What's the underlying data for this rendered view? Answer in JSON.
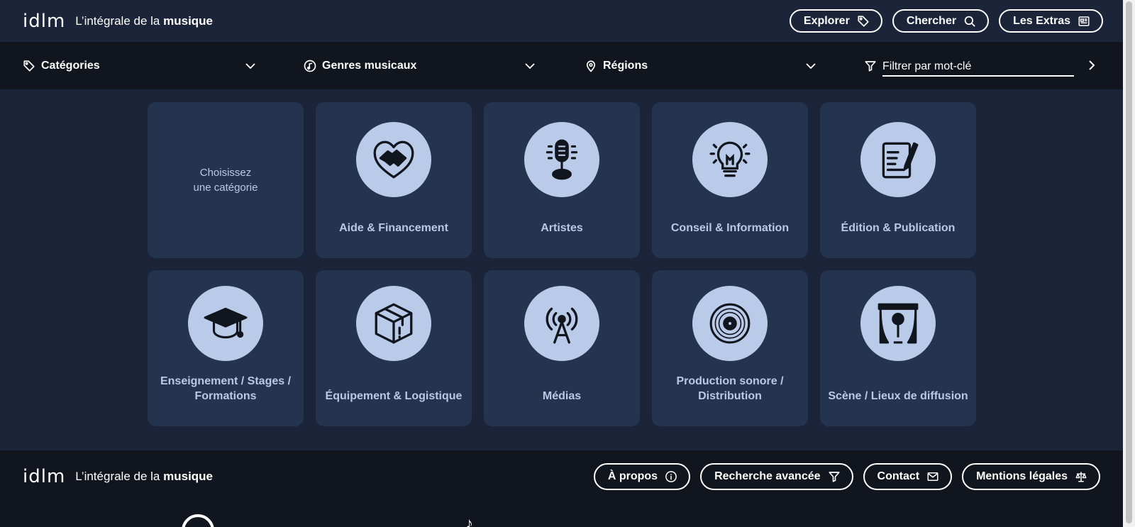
{
  "brand": {
    "logo_mark": "idlm",
    "tagline_prefix": "L’intégrale de la ",
    "tagline_bold": "musique"
  },
  "header": {
    "explorer_label": "Explorer",
    "chercher_label": "Chercher",
    "extras_label": "Les Extras"
  },
  "filters": {
    "categories_label": "Catégories",
    "genres_label": "Genres musicaux",
    "regions_label": "Régions",
    "keyword_placeholder": "Filtrer par mot-clé"
  },
  "grid": {
    "placeholder_line1": "Choisissez",
    "placeholder_line2": "une catégorie",
    "categories": [
      {
        "label": "Aide & Financement",
        "icon": "heart-handshake-icon"
      },
      {
        "label": "Artistes",
        "icon": "microphone-icon"
      },
      {
        "label": "Conseil & Information",
        "icon": "lightbulb-icon"
      },
      {
        "label": "Édition & Publication",
        "icon": "notepad-pen-icon"
      },
      {
        "label": "Enseignement / Stages / Formations",
        "icon": "graduation-cap-icon"
      },
      {
        "label": "Équipement & Logistique",
        "icon": "box-icon"
      },
      {
        "label": "Médias",
        "icon": "broadcast-antenna-icon"
      },
      {
        "label": "Production sonore / Distribution",
        "icon": "vinyl-record-icon"
      },
      {
        "label": "Scène / Lieux de diffusion",
        "icon": "stage-curtain-icon"
      }
    ]
  },
  "footer": {
    "about_label": "À propos",
    "advanced_search_label": "Recherche avancée",
    "contact_label": "Contact",
    "legal_label": "Mentions légales"
  },
  "colors": {
    "background": "#1b2438",
    "bar": "#11151d",
    "card": "#24344f",
    "icon_circle": "#b9cbe9",
    "card_text": "#b9c8e4"
  }
}
